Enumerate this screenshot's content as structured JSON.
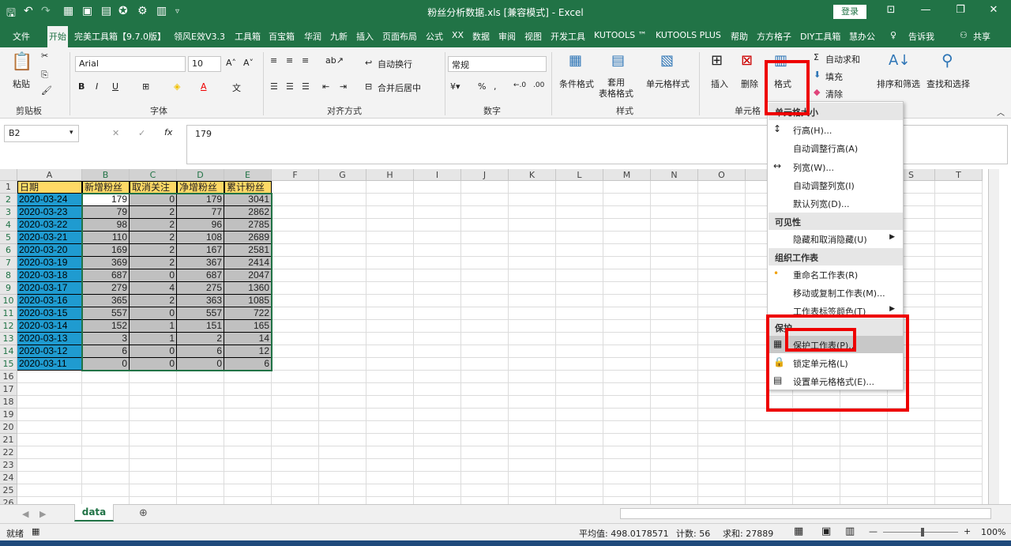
{
  "title": "粉丝分析数据.xls [兼容模式] - Excel",
  "login": "登录",
  "tabs": [
    "文件",
    "开始",
    "完美工具箱【9.7.0版】",
    "领风E效V3.3",
    "工具箱",
    "百宝箱",
    "华润",
    "九新",
    "插入",
    "页面布局",
    "公式",
    "XX",
    "数据",
    "审阅",
    "视图",
    "开发工具",
    "KUTOOLS ™",
    "KUTOOLS PLUS",
    "帮助",
    "方方格子",
    "DIY工具箱",
    "慧办公"
  ],
  "tell_me": "告诉我",
  "share": "共享",
  "ribbon": {
    "paste": "粘贴",
    "font_name": "Arial",
    "font_size": "10",
    "wrap": "自动换行",
    "merge": "合并后居中",
    "number_format": "常规",
    "cond_format": "条件格式",
    "table_format": "套用\n表格格式",
    "cell_style": "单元格样式",
    "insert": "插入",
    "delete": "删除",
    "format": "格式",
    "autosum": "自动求和",
    "fill": "填充",
    "clear": "清除",
    "sort": "排序和筛选",
    "find": "查找和选择",
    "groups": [
      "剪贴板",
      "字体",
      "对齐方式",
      "数字",
      "样式",
      "单元格"
    ]
  },
  "namebox": "B2",
  "formula": "179",
  "columns": [
    "A",
    "B",
    "C",
    "D",
    "E",
    "F",
    "G",
    "H",
    "I",
    "J",
    "K",
    "L",
    "M",
    "N",
    "O",
    "P",
    "Q",
    "R",
    "S",
    "T"
  ],
  "headers": [
    "日期",
    "新增粉丝",
    "取消关注",
    "净增粉丝",
    "累计粉丝"
  ],
  "rows": [
    [
      "2020-03-24",
      "179",
      "0",
      "179",
      "3041"
    ],
    [
      "2020-03-23",
      "79",
      "2",
      "77",
      "2862"
    ],
    [
      "2020-03-22",
      "98",
      "2",
      "96",
      "2785"
    ],
    [
      "2020-03-21",
      "110",
      "2",
      "108",
      "2689"
    ],
    [
      "2020-03-20",
      "169",
      "2",
      "167",
      "2581"
    ],
    [
      "2020-03-19",
      "369",
      "2",
      "367",
      "2414"
    ],
    [
      "2020-03-18",
      "687",
      "0",
      "687",
      "2047"
    ],
    [
      "2020-03-17",
      "279",
      "4",
      "275",
      "1360"
    ],
    [
      "2020-03-16",
      "365",
      "2",
      "363",
      "1085"
    ],
    [
      "2020-03-15",
      "557",
      "0",
      "557",
      "722"
    ],
    [
      "2020-03-14",
      "152",
      "1",
      "151",
      "165"
    ],
    [
      "2020-03-13",
      "3",
      "1",
      "2",
      "14"
    ],
    [
      "2020-03-12",
      "6",
      "0",
      "6",
      "12"
    ],
    [
      "2020-03-11",
      "0",
      "0",
      "0",
      "6"
    ]
  ],
  "menu": {
    "h1": "单元格大小",
    "row_height": "行高(H)...",
    "auto_row": "自动调整行高(A)",
    "col_width": "列宽(W)...",
    "auto_col": "自动调整列宽(I)",
    "default_width": "默认列宽(D)...",
    "h2": "可见性",
    "hide": "隐藏和取消隐藏(U)",
    "h3": "组织工作表",
    "rename": "重命名工作表(R)",
    "move": "移动或复制工作表(M)...",
    "tabcolor": "工作表标签颜色(T)",
    "h4": "保护",
    "protect": "保护工作表(P)...",
    "lock": "锁定单元格(L)",
    "format_cells": "设置单元格格式(E)..."
  },
  "sheet_tab": "data",
  "status": {
    "ready": "就绪",
    "avg": "平均值: 498.0178571",
    "count": "计数: 56",
    "sum": "求和: 27889",
    "zoom": "100%"
  },
  "colors": {
    "accent": "#217346",
    "header_fill": "#ffd966",
    "date_fill": "#1f9bd0",
    "data_fill": "#c0c0c0",
    "red": "#e00000"
  }
}
